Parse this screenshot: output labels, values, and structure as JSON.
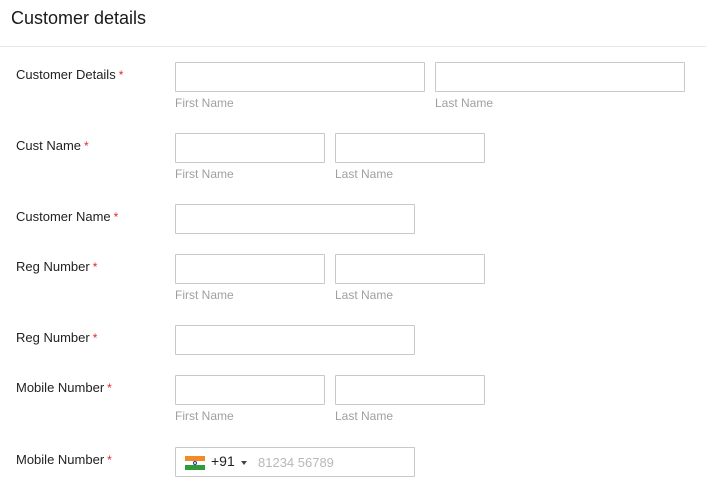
{
  "header": {
    "title": "Customer details"
  },
  "required_mark": "*",
  "rows": [
    {
      "label": "Customer Details",
      "first_hint": "First Name",
      "last_hint": "Last Name"
    },
    {
      "label": "Cust Name",
      "first_hint": "First Name",
      "last_hint": "Last Name"
    },
    {
      "label": "Customer Name"
    },
    {
      "label": "Reg Number",
      "first_hint": "First Name",
      "last_hint": "Last Name"
    },
    {
      "label": "Reg Number"
    },
    {
      "label": "Mobile Number",
      "first_hint": "First Name",
      "last_hint": "Last Name"
    },
    {
      "label": "Mobile Number",
      "country_code": "+91",
      "placeholder": "81234 56789",
      "flag_icon": "india-flag-icon"
    }
  ],
  "colors": {
    "required": "#e0282e",
    "hint": "#a0a0a0",
    "border": "#c9c9c9"
  }
}
